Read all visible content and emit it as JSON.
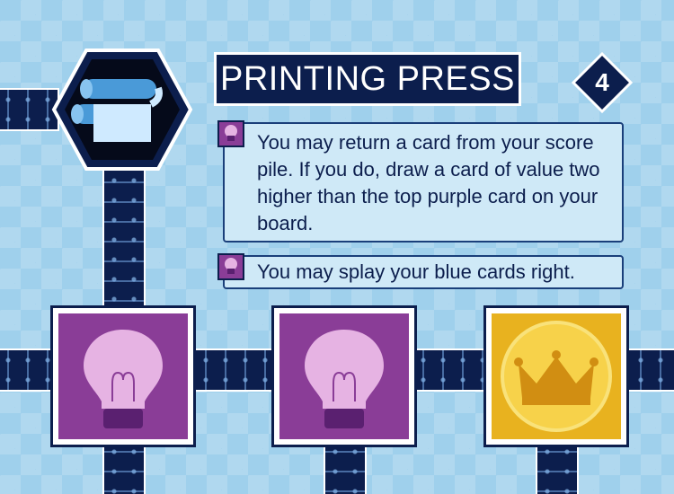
{
  "card": {
    "title": "PRINTING PRESS",
    "age": "4",
    "color": "blue",
    "icons": [
      "printing-press-illustration",
      "lightbulb-icon",
      "lightbulb-icon",
      "crown-icon"
    ],
    "dogmas": [
      {
        "icon": "lightbulb-icon",
        "text": "You may return a card from your score pile. If you do, draw a card of value two higher than the top purple card on your board."
      },
      {
        "icon": "lightbulb-icon",
        "text": "You may splay your blue cards right."
      }
    ]
  },
  "colors": {
    "background": "#9fd0ec",
    "navy": "#0c1e4d",
    "dogma_bg": "#cfe9f7",
    "purple": "#8a3d97",
    "gold": "#e8b21f",
    "bulb": "#e6b3e3"
  }
}
